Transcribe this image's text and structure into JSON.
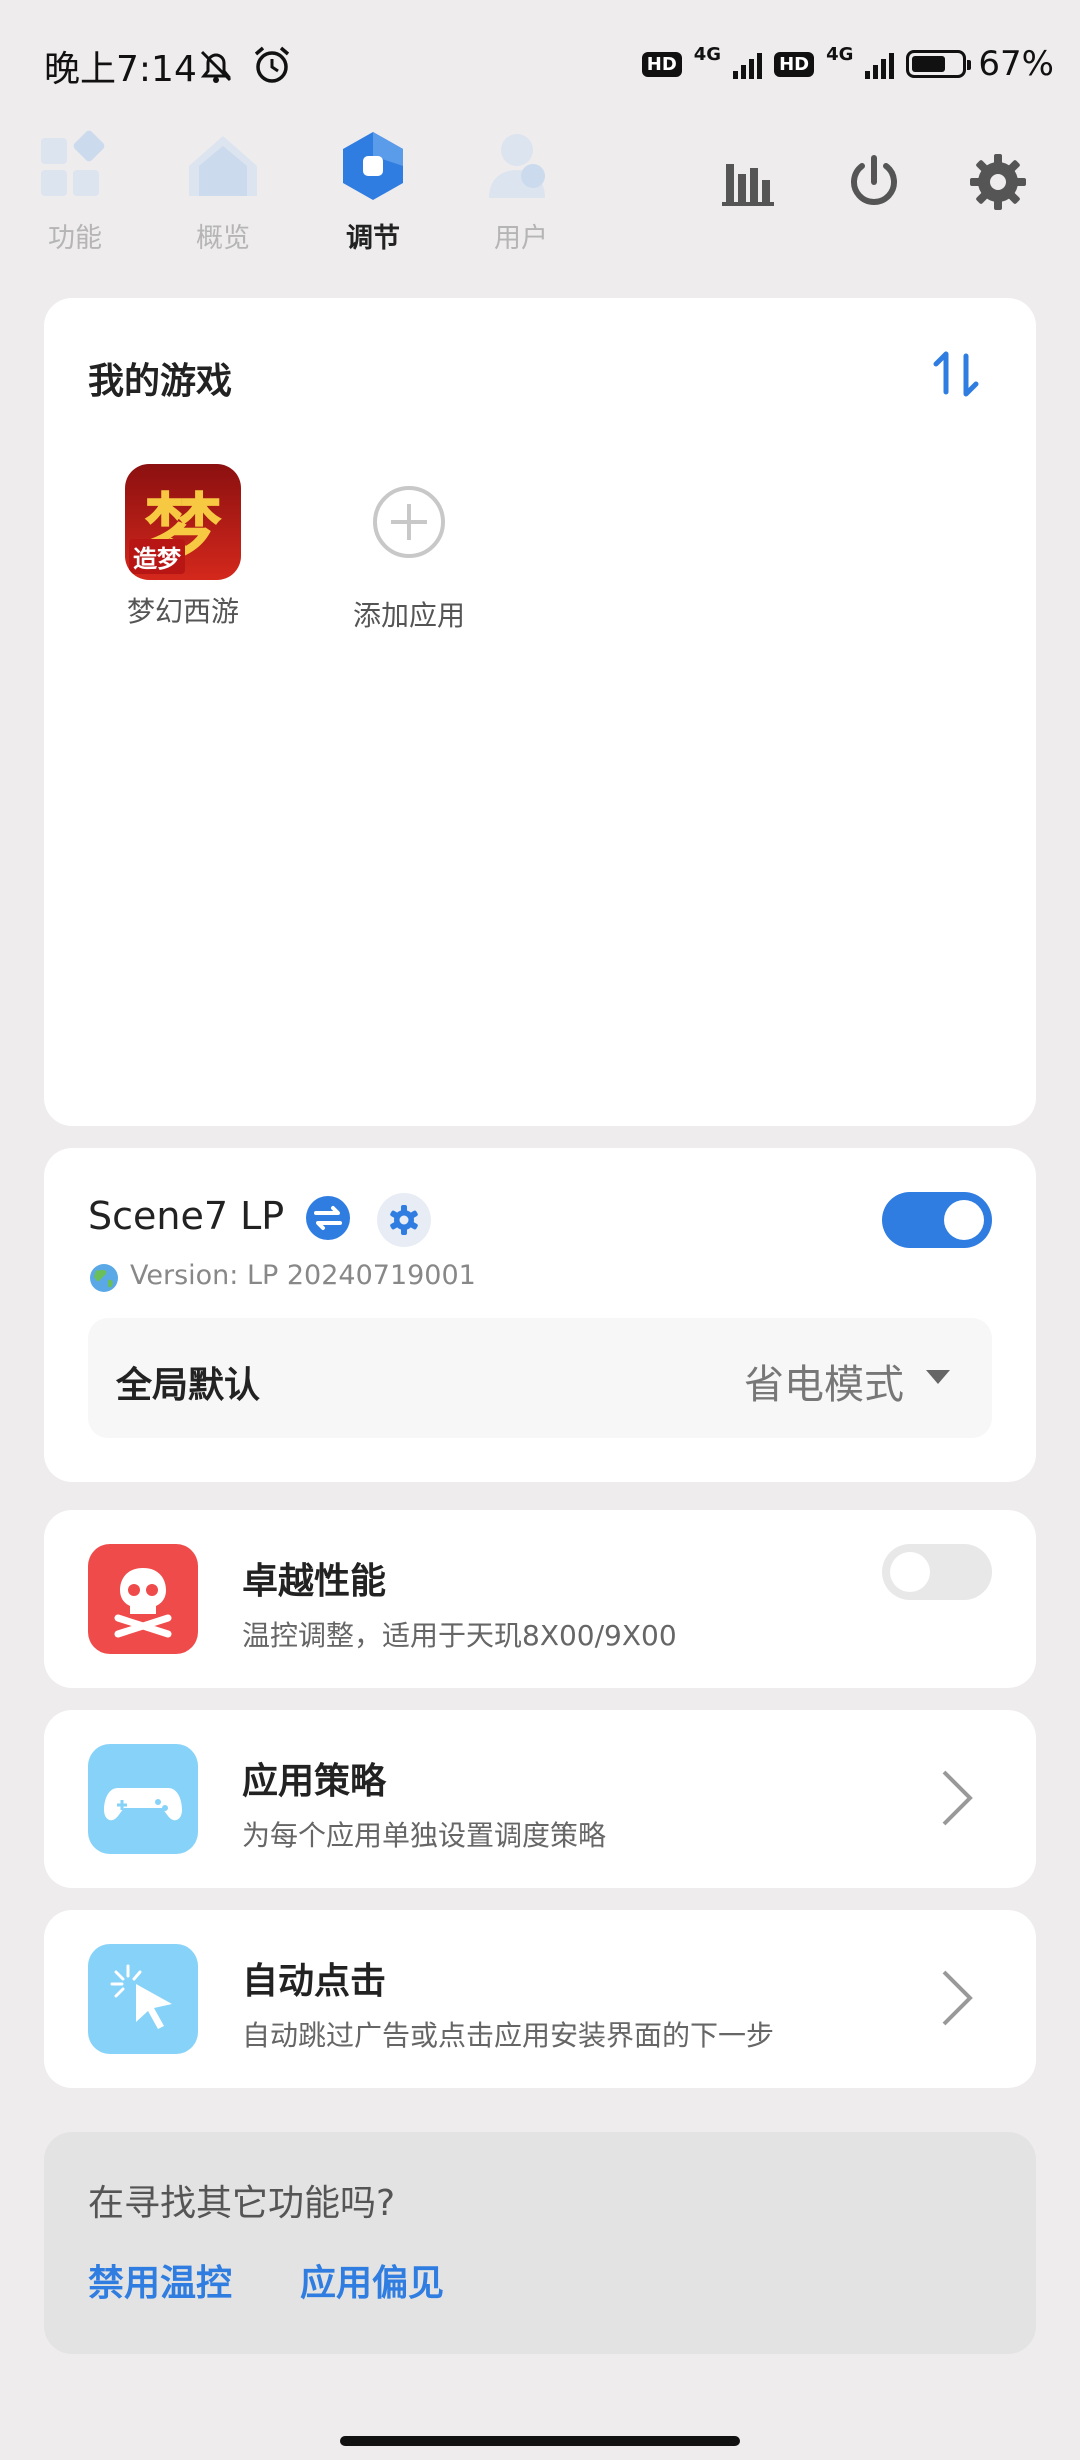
{
  "status": {
    "time": "晚上7:14",
    "net1": "4G",
    "net2": "4G",
    "hd": "HD",
    "battery_level": 0.67,
    "battery": "67%"
  },
  "tabs": [
    {
      "label": "功能"
    },
    {
      "label": "概览"
    },
    {
      "label": "调节"
    },
    {
      "label": "用户"
    }
  ],
  "games": {
    "title": "我的游戏",
    "items": [
      {
        "label": "梦幻西游",
        "icon_char": "梦",
        "icon_badge": "造梦"
      }
    ],
    "add_label": "添加应用"
  },
  "scene": {
    "title": "Scene7 LP",
    "version": "Version: LP 20240719001",
    "mode_label": "全局默认",
    "mode_value": "省电模式",
    "enabled": true
  },
  "perf": {
    "title": "卓越性能",
    "subtitle": "温控调整，适用于天玑8X00/9X00",
    "enabled": false
  },
  "policy": {
    "title": "应用策略",
    "subtitle": "为每个应用单独设置调度策略"
  },
  "autoclick": {
    "title": "自动点击",
    "subtitle": "自动跳过广告或点击应用安装界面的下一步"
  },
  "more": {
    "title": "在寻找其它功能吗?",
    "link1": "禁用温控",
    "link2": "应用偏见"
  },
  "colors": {
    "accent": "#2F7DE1",
    "danger": "#F04B4B",
    "light_blue": "#86D2F8"
  }
}
